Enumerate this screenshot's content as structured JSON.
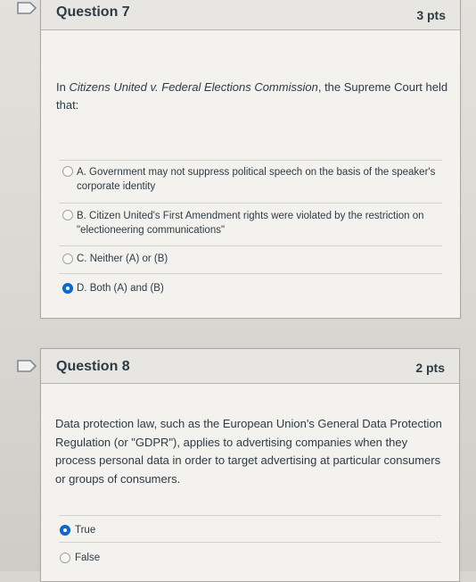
{
  "questions": [
    {
      "title": "Question 7",
      "points": "3 pts",
      "prompt_italic": "Citizens United v. Federal Elections Commission",
      "prompt_before": "In ",
      "prompt_after": ", the Supreme Court held that:",
      "answers": [
        {
          "label": "A. Government may not suppress political speech on the basis of the speaker's corporate identity",
          "checked": false
        },
        {
          "label": "B. Citizen United's First Amendment rights were violated by the restriction on \"electioneering communications\"",
          "checked": false
        },
        {
          "label": "C. Neither (A) or (B)",
          "checked": false
        },
        {
          "label": "D. Both (A) and (B)",
          "checked": true
        }
      ]
    },
    {
      "title": "Question 8",
      "points": "2 pts",
      "prompt": "Data protection law, such as the European Union's General Data Protection Regulation (or \"GDPR\"), applies to advertising companies when they process personal data in order to target advertising at particular consumers or groups of consumers.",
      "answers": [
        {
          "label": "True",
          "checked": true
        },
        {
          "label": "False",
          "checked": false
        }
      ]
    }
  ],
  "colors": {
    "selected_radio": "#0b6bd6",
    "flag_outline": "#7b8a96"
  },
  "icons": {
    "flag": "flag-question-icon"
  }
}
